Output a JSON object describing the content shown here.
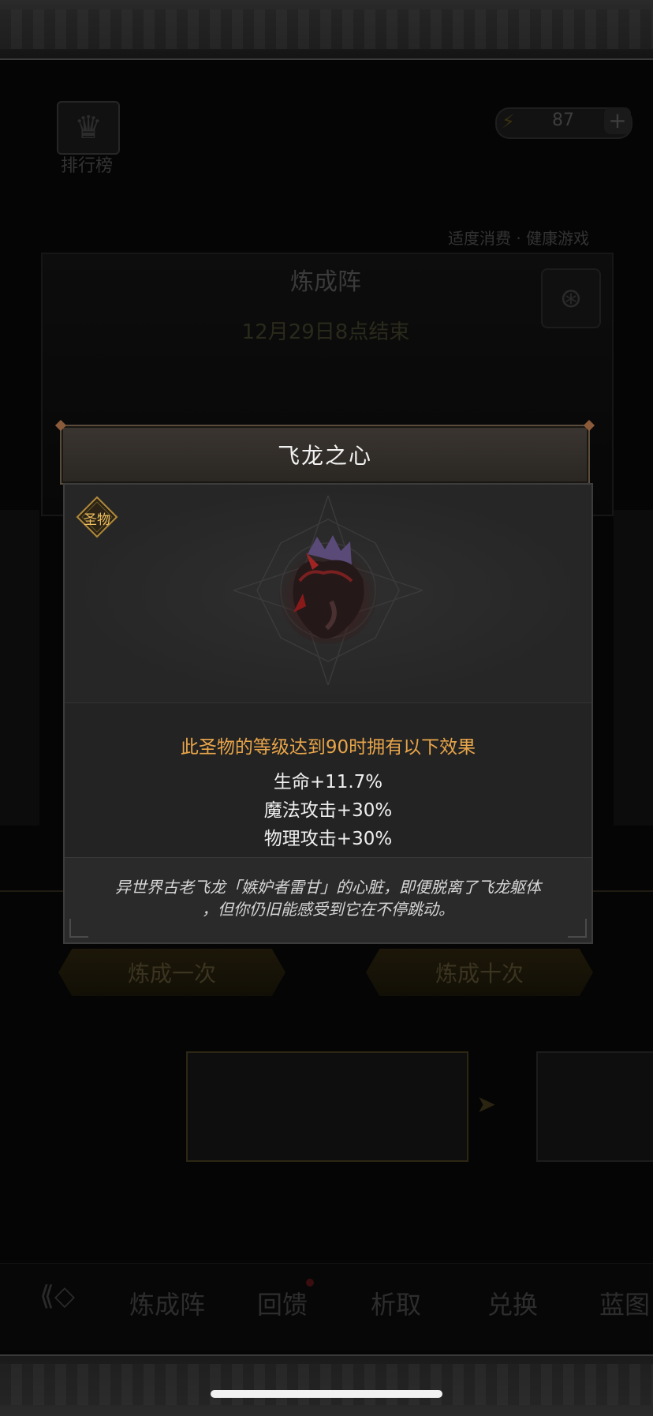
{
  "background": {
    "rank_label": "排行榜",
    "currency_value": "87",
    "currency_plus": "+",
    "top_links": "适度消费 · 健康游戏",
    "banner_title": "炼成阵",
    "banner_subtitle": "12月29日8点结束",
    "buttons": {
      "once": "炼成一次",
      "ten": "炼成十次"
    },
    "nav": {
      "tabs": [
        "炼成阵",
        "回馈",
        "析取",
        "兑换",
        "蓝图"
      ]
    }
  },
  "modal": {
    "title": "飞龙之心",
    "badge": "圣物",
    "effect_header": "此圣物的等级达到90时拥有以下效果",
    "effects": [
      "生命+11.7%",
      "魔法攻击+30%",
      "物理攻击+30%"
    ],
    "lore_line1": "异世界古老飞龙「嫉妒者雷甘」的心脏，即便脱离了飞龙躯体",
    "lore_line2": "，但你仍旧能感受到它在不停跳动。"
  },
  "colors": {
    "accent_gold": "#e8a54a",
    "text_white": "#f0f0f0",
    "modal_bg": "#2a2a2a"
  },
  "icons": {
    "rank": "crown-icon",
    "currency": "lightning-icon",
    "relic": "heart-relic-icon",
    "nav_back": "back-diamond-icon"
  }
}
